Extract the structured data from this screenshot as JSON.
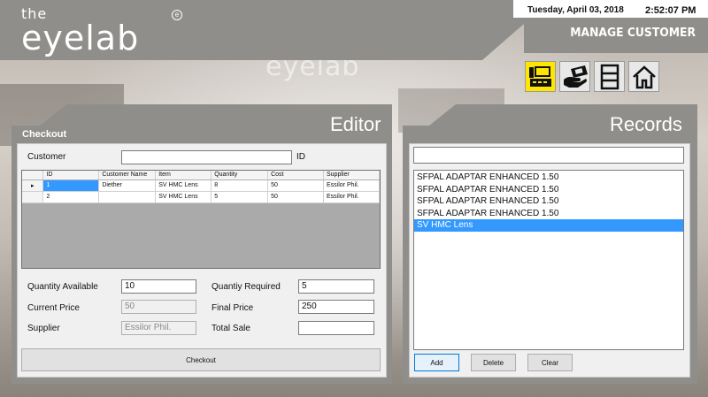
{
  "header": {
    "logo_the": "the",
    "logo_main": "eyelab",
    "logo_reg": "e",
    "date": "Tuesday, April 03, 2018",
    "time": "2:52:07 PM",
    "page_title": "MANAGE CUSTOMER",
    "background_sign": "eyelab"
  },
  "toolbar": {
    "icons": [
      "cash-register-icon",
      "payment-hand-icon",
      "list-icon",
      "home-icon"
    ],
    "active_color": "#ffe600"
  },
  "editor": {
    "title": "Editor",
    "section_label": "Checkout",
    "customer_label": "Customer",
    "customer_value": "",
    "id_label": "ID",
    "grid": {
      "columns": [
        "ID",
        "Customer Name",
        "Item",
        "Quantity",
        "Cost",
        "Supplier"
      ],
      "rows": [
        {
          "indicator": "▸",
          "cells": [
            "1",
            "Diether",
            "SV HMC Lens",
            "8",
            "50",
            "Essilor Phil."
          ]
        },
        {
          "indicator": "",
          "cells": [
            "2",
            "",
            "SV HMC Lens",
            "5",
            "50",
            "Essilor Phil."
          ]
        }
      ]
    },
    "quantity_available_label": "Quantity Available",
    "quantity_available_value": "10",
    "quantity_required_label": "Quantiy Required",
    "quantity_required_value": "5",
    "current_price_label": "Current Price",
    "current_price_value": "50",
    "final_price_label": "Final Price",
    "final_price_value": "250",
    "supplier_label": "Supplier",
    "supplier_value": "Essilor Phil.",
    "total_sale_label": "Total Sale",
    "total_sale_value": "",
    "checkout_button": "Checkout"
  },
  "records": {
    "title": "Records",
    "search_value": "",
    "items": [
      "SFPAL ADAPTAR ENHANCED 1.50",
      "SFPAL ADAPTAR ENHANCED 1.50",
      "SFPAL ADAPTAR ENHANCED 1.50",
      "SFPAL ADAPTAR ENHANCED 1.50",
      "SV HMC Lens"
    ],
    "selected_index": 4,
    "add_button": "Add",
    "delete_button": "Delete",
    "clear_button": "Clear"
  },
  "colors": {
    "panel": "#8f8e8b",
    "selection": "#3399ff"
  }
}
